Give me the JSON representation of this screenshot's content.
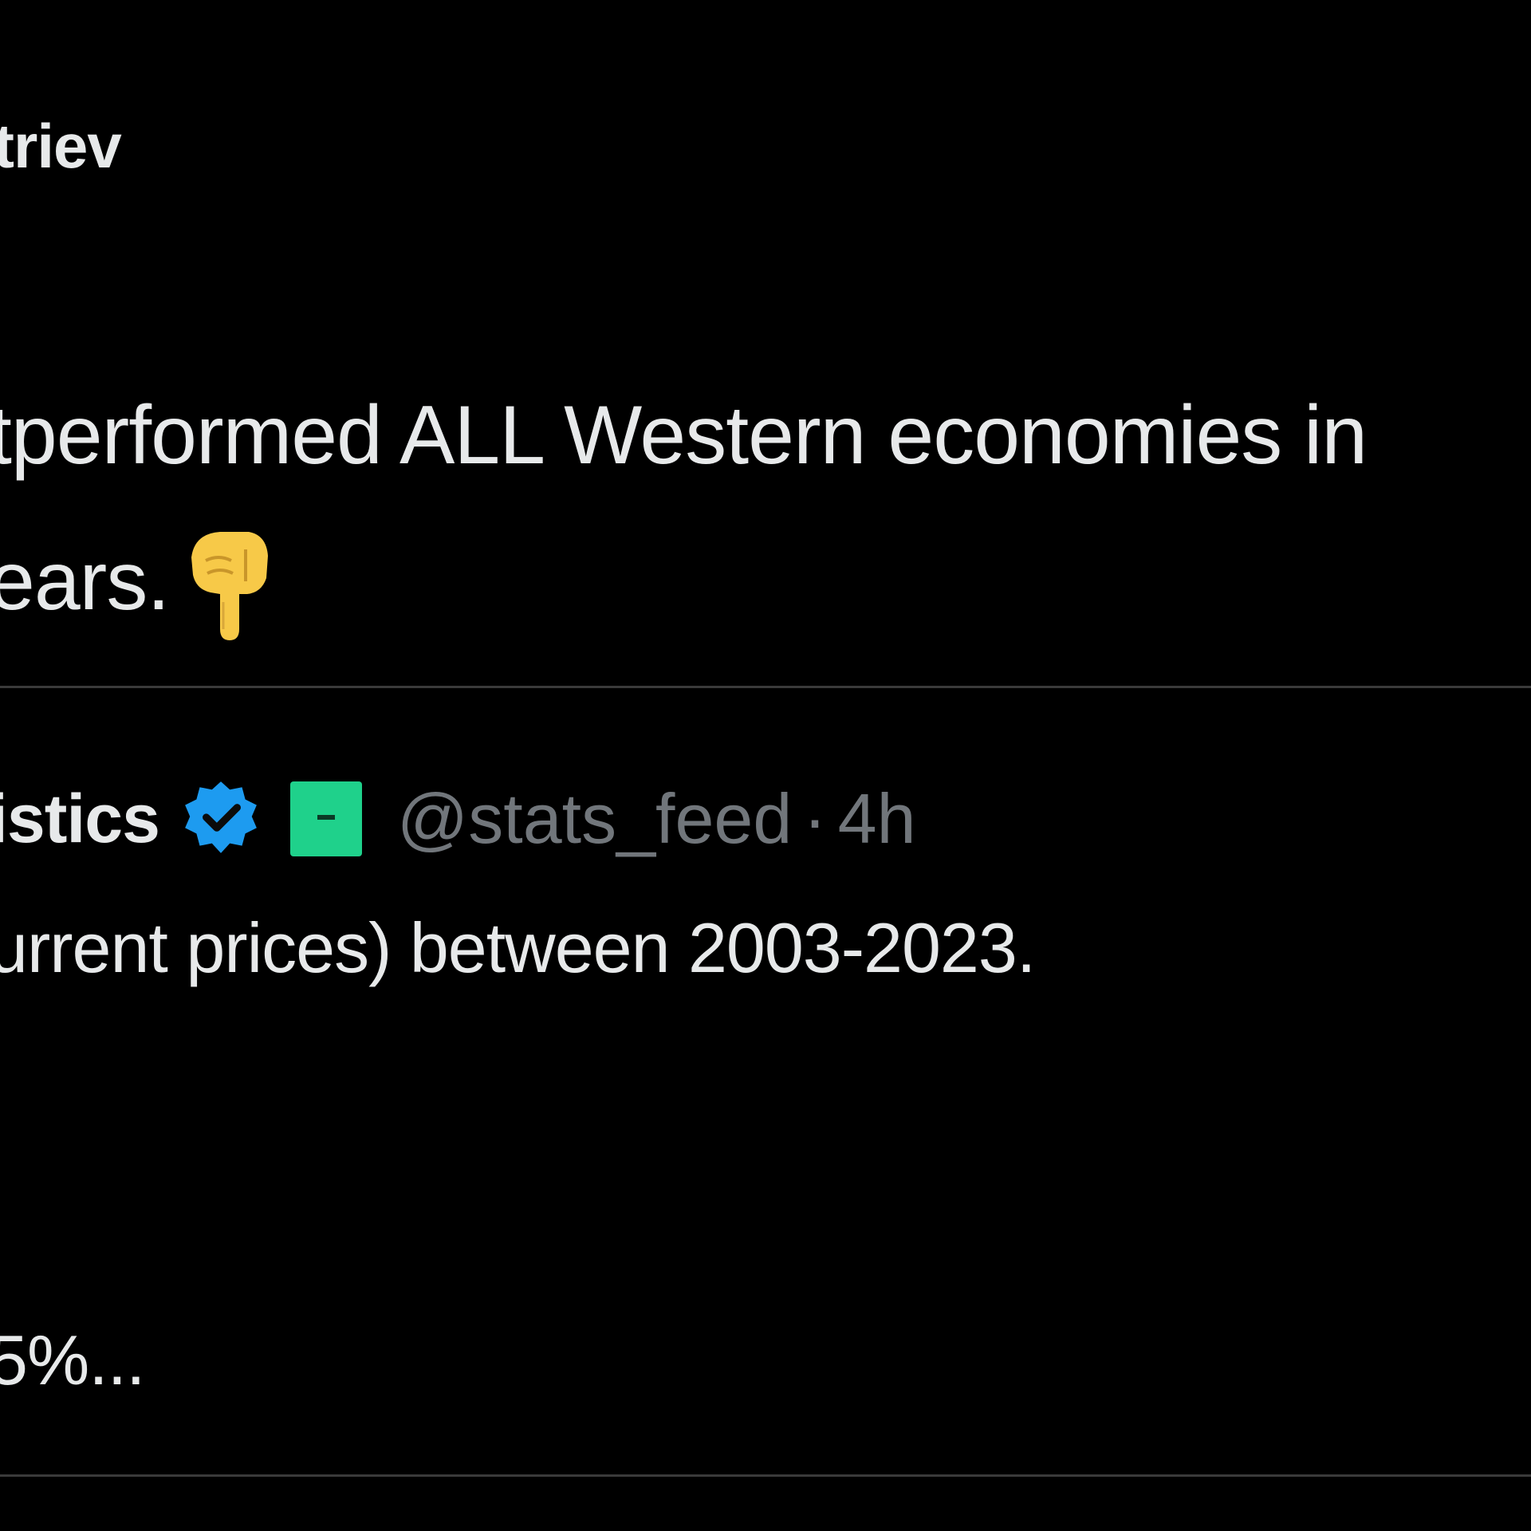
{
  "post": {
    "author_name": "triev",
    "text_line_1": "tperformed ALL Western economies in",
    "text_line_2": "ears.",
    "emoji": "backhand-index-pointing-down"
  },
  "quoted_post": {
    "author_name": "istics",
    "handle": "@stats_feed",
    "separator": "·",
    "time": "4h",
    "text_line_1": "urrent prices) between 2003-2023.",
    "text_line_2": "5%..."
  },
  "colors": {
    "background": "#000000",
    "text_primary": "#e7e9ea",
    "text_secondary": "#71767b",
    "verified_blue": "#1d9bf0",
    "affiliate_green": "#1fd18b",
    "divider": "#3a3a3a"
  }
}
